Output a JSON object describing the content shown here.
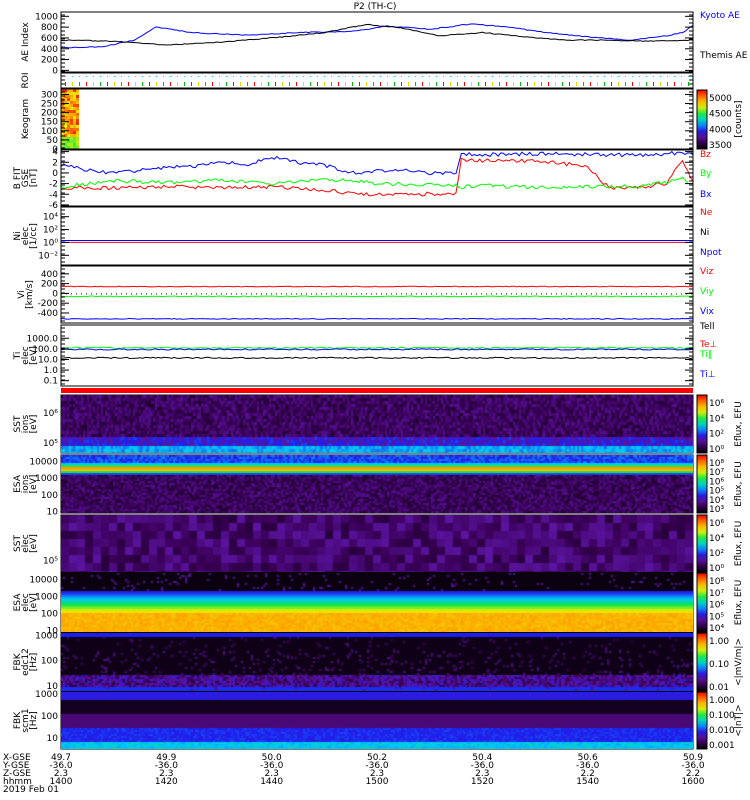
{
  "title": "P2 (TH-C)",
  "chart_data": {
    "type": "line",
    "xlabel": "hhmm",
    "date": "2019 Feb 01",
    "xlim": [
      1400,
      1600
    ],
    "xaxis_rows": [
      {
        "label": "X-GSE",
        "values": [
          "49.7",
          "49.9",
          "50.0",
          "50.2",
          "50.4",
          "50.6",
          "50.9"
        ]
      },
      {
        "label": "Y-GSE",
        "values": [
          "-36.0",
          "-36.0",
          "-36.0",
          "-36.0",
          "-36.0",
          "-36.0",
          "-36.0"
        ]
      },
      {
        "label": "Z-GSE",
        "values": [
          "2.3",
          "2.3",
          "2.3",
          "2.3",
          "2.3",
          "2.2",
          "2.2"
        ]
      },
      {
        "label": "hhmm",
        "values": [
          "1400",
          "1420",
          "1440",
          "1500",
          "1520",
          "1540",
          "1600"
        ]
      }
    ],
    "x_tick_minutes": [
      0,
      20,
      40,
      60,
      80,
      100,
      120
    ],
    "panels": [
      {
        "id": "ae",
        "ylabel": [
          "AE Index"
        ],
        "scale": "linear",
        "ylim": [
          -30,
          1080
        ],
        "yticks": [
          {
            "v": 0,
            "t": "0"
          },
          {
            "v": 200,
            "t": "200"
          },
          {
            "v": 400,
            "t": "400"
          },
          {
            "v": 600,
            "t": "600"
          },
          {
            "v": 800,
            "t": "800"
          },
          {
            "v": 1000,
            "t": "1000"
          }
        ],
        "series": [
          {
            "name": "Kyoto AE",
            "color": "#0000ff",
            "x": [
              0,
              8,
              14,
              18,
              25,
              35,
              45,
              55,
              62,
              70,
              78,
              85,
              92,
              100,
              108,
              115,
              118,
              120
            ],
            "y": [
              420,
              440,
              560,
              800,
              700,
              650,
              700,
              720,
              820,
              760,
              860,
              800,
              700,
              620,
              560,
              640,
              700,
              830
            ]
          },
          {
            "name": "Themis AE",
            "color": "#000000",
            "x": [
              0,
              10,
              20,
              30,
              40,
              50,
              58,
              65,
              72,
              80,
              88,
              96,
              104,
              112,
              120
            ],
            "y": [
              560,
              540,
              470,
              520,
              600,
              700,
              850,
              780,
              640,
              700,
              620,
              560,
              560,
              540,
              560
            ]
          }
        ]
      },
      {
        "id": "roi",
        "ylabel": [
          "ROI"
        ],
        "scale": "none",
        "yticks": []
      },
      {
        "id": "keo",
        "ylabel": [
          "Keogram"
        ],
        "scale": "linear",
        "ylim": [
          0,
          330
        ],
        "yticks": [
          {
            "v": 0,
            "t": "0"
          },
          {
            "v": 50,
            "t": "50"
          },
          {
            "v": 100,
            "t": "100"
          },
          {
            "v": 150,
            "t": "150"
          },
          {
            "v": 200,
            "t": "200"
          },
          {
            "v": 250,
            "t": "250"
          },
          {
            "v": 300,
            "t": "300"
          }
        ],
        "colorbar": {
          "ticks": [
            "3500",
            "4000",
            "4500",
            "5000"
          ],
          "label": "[counts]"
        }
      },
      {
        "id": "b",
        "ylabel": [
          "B FIT",
          "GSE",
          "[nT]"
        ],
        "scale": "linear",
        "ylim": [
          -6.2,
          4.3
        ],
        "yticks": [
          {
            "v": -6,
            "t": "-6"
          },
          {
            "v": -4,
            "t": "-4"
          },
          {
            "v": -2,
            "t": "-2"
          },
          {
            "v": 0,
            "t": "0"
          },
          {
            "v": 2,
            "t": "2"
          },
          {
            "v": 4,
            "t": "4"
          }
        ],
        "series": [
          {
            "name": "Bz",
            "color": "#ff0000",
            "x": [
              0,
              10,
              20,
              30,
              40,
              50,
              55,
              60,
              65,
              70,
              75,
              76,
              80,
              90,
              95,
              100,
              104,
              110,
              115,
              117,
              118,
              120
            ],
            "y": [
              -2.8,
              -2.8,
              -2.6,
              -2.7,
              -2.6,
              -3.2,
              -3.8,
              -4,
              -4.1,
              -3.9,
              -4,
              2.5,
              2.3,
              2.2,
              1.8,
              1.2,
              -2.8,
              -2.6,
              -2,
              1,
              2,
              -1.5
            ]
          },
          {
            "name": "By",
            "color": "#00ff00",
            "x": [
              0,
              10,
              20,
              30,
              40,
              50,
              55,
              60,
              70,
              75,
              76,
              80,
              90,
              100,
              110,
              118,
              120
            ],
            "y": [
              -2.6,
              -1.5,
              -1.8,
              -1.4,
              -2,
              -1.2,
              -1.5,
              -2,
              -2.2,
              -2.4,
              -2.6,
              -2.3,
              -2.8,
              -2.6,
              -2.5,
              -1.2,
              -2
            ]
          },
          {
            "name": "Bx",
            "color": "#0000ff",
            "x": [
              0,
              5,
              10,
              20,
              25,
              30,
              35,
              40,
              45,
              50,
              55,
              60,
              65,
              70,
              75,
              76,
              80,
              90,
              100,
              110,
              118,
              120
            ],
            "y": [
              1.5,
              0.5,
              0,
              1,
              1.2,
              2.2,
              1.5,
              3,
              2,
              1.5,
              0,
              0.3,
              0.5,
              0,
              0,
              3.5,
              3.4,
              3.6,
              3.5,
              3.3,
              3.8,
              3.4
            ]
          }
        ]
      },
      {
        "id": "ni",
        "ylabel": [
          "Ni",
          "elec",
          "[1/cc]"
        ],
        "scale": "log",
        "ylim": [
          -3.5,
          5.5
        ],
        "yticks": [
          {
            "v": -2,
            "t": "10⁻²"
          },
          {
            "v": 0,
            "t": "10⁰"
          },
          {
            "v": 2,
            "t": "10²"
          },
          {
            "v": 4,
            "t": "10⁴"
          }
        ],
        "series": [
          {
            "name": "Ne",
            "color": "#ff0000",
            "x": [
              0,
              120
            ],
            "y": [
              0.0,
              0.0
            ]
          },
          {
            "name": "Ni",
            "color": "#000000",
            "x": [],
            "y": []
          },
          {
            "name": "Npot",
            "color": "#0000ff",
            "x": [
              0,
              120
            ],
            "y": [
              0.3,
              0.3
            ]
          }
        ]
      },
      {
        "id": "vi",
        "ylabel": [
          "Vi",
          "[km/s]"
        ],
        "scale": "linear",
        "ylim": [
          -605,
          560
        ],
        "yticks": [
          {
            "v": -400,
            "t": "-400"
          },
          {
            "v": -200,
            "t": "-200"
          },
          {
            "v": 0,
            "t": "0"
          },
          {
            "v": 200,
            "t": "200"
          },
          {
            "v": 400,
            "t": "400"
          }
        ],
        "series": [
          {
            "name": "Viz",
            "color": "#ff0000",
            "x": [
              0,
              120
            ],
            "y": [
              140,
              140
            ]
          },
          {
            "name": "Viy",
            "color": "#00ff00",
            "x": [
              0,
              120
            ],
            "y": [
              -60,
              -60
            ]
          },
          {
            "name": "Vix",
            "color": "#0000ff",
            "x": [
              0,
              120
            ],
            "y": [
              -520,
              -520
            ]
          }
        ]
      },
      {
        "id": "ti",
        "ylabel": [
          "Ti",
          "elec",
          "[eV]"
        ],
        "scale": "log",
        "ylim": [
          -1.5,
          4.25
        ],
        "yticks": [
          {
            "v": -1,
            "t": "0.1"
          },
          {
            "v": 0,
            "t": "1.0"
          },
          {
            "v": 1,
            "t": "10.0"
          },
          {
            "v": 2,
            "t": "100.0"
          },
          {
            "v": 3,
            "t": "1000.0"
          }
        ],
        "series": [
          {
            "name": "Tell",
            "color": "#000000",
            "x": [
              0,
              120
            ],
            "y": [
              1.15,
              1.15
            ]
          },
          {
            "name": "Te⊥",
            "color": "#ff0000",
            "x": [],
            "y": []
          },
          {
            "name": "Ti‖",
            "color": "#00ff00",
            "x": [
              0,
              120
            ],
            "y": [
              2.1,
              2.1
            ]
          },
          {
            "name": "Ti⊥",
            "color": "#0000ff",
            "x": [
              0,
              120
            ],
            "y": [
              1.95,
              1.95
            ]
          }
        ]
      },
      {
        "id": "sst_i",
        "ylabel": [
          "SST",
          "ions",
          "[eV]"
        ],
        "scale": "log",
        "ylim": [
          4.67,
          6.6
        ],
        "yticks": [
          {
            "v": 5,
            "t": "10⁵"
          },
          {
            "v": 6,
            "t": "10⁶"
          }
        ],
        "colorbar": {
          "ticks": [
            "10⁰",
            "10²",
            "10⁴",
            "10⁶"
          ],
          "label": "Eflux, EFU"
        }
      },
      {
        "id": "esa_i",
        "ylabel": [
          "ESA",
          "ions",
          "[eV]"
        ],
        "scale": "log",
        "ylim": [
          0.9,
          4.4
        ],
        "yticks": [
          {
            "v": 1,
            "t": "10"
          },
          {
            "v": 2,
            "t": "100"
          },
          {
            "v": 3,
            "t": "1000"
          },
          {
            "v": 4,
            "t": "10000"
          }
        ],
        "colorbar": {
          "ticks": [
            "10³",
            "10⁴",
            "10⁵",
            "10⁶",
            "10⁷",
            "10⁸"
          ],
          "label": "Eflux, EFU"
        }
      },
      {
        "id": "sst_e",
        "ylabel": [
          "SST",
          "elec",
          "[eV]"
        ],
        "scale": "log",
        "ylim": [
          4.6,
          6.6
        ],
        "yticks": [
          {
            "v": 5,
            "t": "10⁵"
          }
        ],
        "colorbar": {
          "ticks": [
            "10⁰",
            "10²",
            "10⁴",
            "10⁶"
          ],
          "label": "Eflux, EFU"
        }
      },
      {
        "id": "esa_e",
        "ylabel": [
          "ESA",
          "elec",
          "[eV]"
        ],
        "scale": "log",
        "ylim": [
          0.9,
          4.4
        ],
        "yticks": [
          {
            "v": 1,
            "t": "10"
          },
          {
            "v": 2,
            "t": "100"
          },
          {
            "v": 3,
            "t": "1000"
          },
          {
            "v": 4,
            "t": "10000"
          }
        ],
        "colorbar": {
          "ticks": [
            "10⁴",
            "10⁵",
            "10⁶",
            "10⁷",
            "10⁸"
          ],
          "label": "Eflux, EFU"
        }
      },
      {
        "id": "fbk1",
        "ylabel": [
          "FBK",
          "edc12",
          "[Hz]"
        ],
        "scale": "log",
        "ylim": [
          0.8,
          3.1
        ],
        "yticks": [
          {
            "v": 1,
            "t": "10"
          },
          {
            "v": 2,
            "t": "100"
          },
          {
            "v": 3,
            "t": "1000"
          }
        ],
        "colorbar": {
          "ticks": [
            "0.01",
            "0.10",
            "1.00"
          ],
          "label": "<|mV/m|>"
        }
      },
      {
        "id": "fbk2",
        "ylabel": [
          "FBK",
          "scm1",
          "[Hz]"
        ],
        "scale": "log",
        "ylim": [
          0.5,
          3.1
        ],
        "yticks": [
          {
            "v": 1,
            "t": "10"
          },
          {
            "v": 2,
            "t": "100"
          },
          {
            "v": 3,
            "t": "1000"
          }
        ],
        "colorbar": {
          "ticks": [
            "0.001",
            "0.010",
            "0.100",
            "1.000"
          ],
          "label": "<|nT|>"
        }
      }
    ]
  }
}
